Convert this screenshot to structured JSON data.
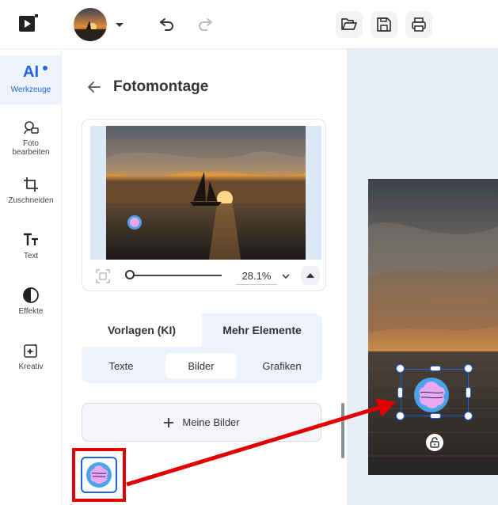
{
  "colors": {
    "accent": "#1f64e6",
    "annotation": "#e10000",
    "rail_active_bg": "#eef3fd"
  },
  "topbar": {
    "icons": [
      "app-logo-icon",
      "avatar",
      "chevron-down-icon",
      "undo-icon",
      "redo-icon",
      "folder-open-icon",
      "save-icon",
      "print-icon"
    ]
  },
  "rail": {
    "items": [
      {
        "badge": "AI",
        "label": "Werkzeuge",
        "icon": "ai-icon",
        "active": true
      },
      {
        "label": "Foto\nbearbeiten",
        "icon": "photo-edit-icon"
      },
      {
        "label": "Zuschneiden",
        "icon": "crop-icon"
      },
      {
        "label": "Text",
        "icon": "text-icon"
      },
      {
        "label": "Effekte",
        "icon": "effects-icon"
      },
      {
        "label": "Kreativ",
        "icon": "creative-icon"
      }
    ]
  },
  "panel": {
    "title": "Fotomontage",
    "zoom": {
      "value": "28.1%"
    },
    "tabs": [
      {
        "label": "Vorlagen (KI)"
      },
      {
        "label": "Mehr Elemente"
      }
    ],
    "subtabs": [
      {
        "label": "Texte"
      },
      {
        "label": "Bilder"
      },
      {
        "label": "Grafiken"
      }
    ],
    "my_images_label": "Meine Bilder"
  }
}
